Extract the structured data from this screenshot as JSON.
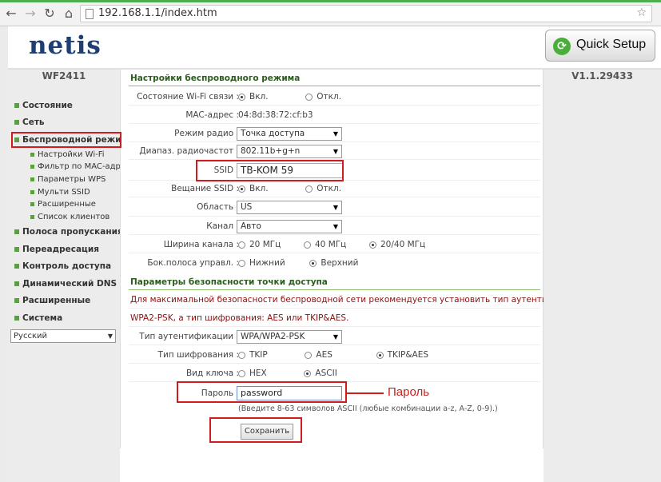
{
  "browser": {
    "url_host": "192.168.1.1",
    "url_path": "/index.htm"
  },
  "header": {
    "logo": "netis",
    "quick_setup": "Quick Setup"
  },
  "model": "WF2411",
  "version": "V1.1.29433",
  "menu": {
    "status": "Состояние",
    "network": "Сеть",
    "wireless": "Беспроводной режим",
    "sub": [
      "Настройки Wi-Fi",
      "Фильтр по MAC-адр.",
      "Параметры WPS",
      "Мульти SSID",
      "Расширенные",
      "Список клиентов"
    ],
    "bandwidth": "Полоса пропускания",
    "forwarding": "Переадресация",
    "access": "Контроль доступа",
    "ddns": "Динамический DNS",
    "advanced": "Расширенные",
    "system": "Система",
    "language": "Русский"
  },
  "wireless": {
    "title": "Настройки беспроводного режима",
    "state_label": "Состояние Wi-Fi связи :",
    "on": "Вкл.",
    "off": "Откл.",
    "mac_label": "MAC-адрес :",
    "mac_value": "04:8d:38:72:cf:b3",
    "radio_mode_label": "Режим радио :",
    "radio_mode_value": "Точка доступа",
    "band_label": "Диапаз. радиочастот :",
    "band_value": "802.11b+g+n",
    "ssid_label": "SSID :",
    "ssid_value": "TB-KOM 59",
    "broadcast_label": "Вещание SSID :",
    "region_label": "Область :",
    "region_value": "US",
    "channel_label": "Канал :",
    "channel_value": "Авто",
    "width_label": "Ширина канала :",
    "width_20": "20 МГц",
    "width_40": "40 МГц",
    "width_2040": "20/40 МГц",
    "sideband_label": "Бок.полоса управл. :",
    "sideband_low": "Нижний",
    "sideband_high": "Верхний"
  },
  "security": {
    "title": "Параметры безопасности точки доступа",
    "notice1": "Для максимальной безопасности беспроводной сети рекомендуется установить тип аутентификации:",
    "notice2": "WPA2-PSK, а тип шифрования: AES или TKIP&AES.",
    "auth_label": "Тип аутентификации :",
    "auth_value": "WPA/WPA2-PSK",
    "enc_label": "Тип шифрования :",
    "enc_tkip": "TKIP",
    "enc_aes": "AES",
    "enc_tkipaes": "TKIP&AES",
    "key_label": "Вид ключа :",
    "key_hex": "HEX",
    "key_ascii": "ASCII",
    "pass_label": "Пароль :",
    "pass_value": "password",
    "pass_hint": "(Введите 8-63 символов ASCII (любые комбинации a-z, A-Z, 0-9).)",
    "save": "Сохранить"
  },
  "annotation": {
    "password_note": "Пароль"
  },
  "colors": {
    "accent_green": "#5aa040",
    "highlight_red": "#d01c1c",
    "logo_blue": "#1f3f73"
  }
}
